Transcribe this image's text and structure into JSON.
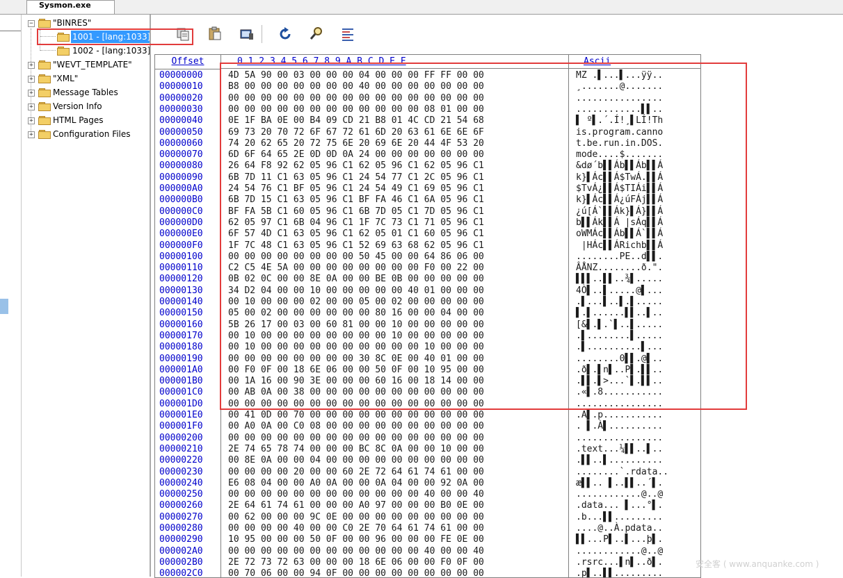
{
  "tab": {
    "title": "Sysmon.exe"
  },
  "tree": {
    "items": [
      {
        "label": "\"BINRES\"",
        "expander": "−",
        "level": 0
      },
      {
        "label": "1001 - [lang:1033]",
        "level": 1,
        "selected": true
      },
      {
        "label": "1002 - [lang:1033]",
        "level": 1
      },
      {
        "label": "\"WEVT_TEMPLATE\"",
        "expander": "+",
        "level": 0
      },
      {
        "label": "\"XML\"",
        "expander": "+",
        "level": 0
      },
      {
        "label": "Message Tables",
        "expander": "+",
        "level": 0
      },
      {
        "label": "Version Info",
        "expander": "+",
        "level": 0
      },
      {
        "label": "HTML Pages",
        "expander": "+",
        "level": 0
      },
      {
        "label": "Configuration Files",
        "expander": "+",
        "level": 0
      }
    ]
  },
  "toolbar": {
    "buttons": [
      {
        "name": "copy-icon"
      },
      {
        "name": "paste-icon"
      },
      {
        "name": "export-icon"
      },
      {
        "name": "refresh-icon"
      },
      {
        "name": "find-icon"
      },
      {
        "name": "properties-icon"
      }
    ]
  },
  "hex": {
    "header": {
      "offset": "Offset",
      "columns": "0  1  2  3  4  5  6  7  8  9  A  B  C  D  E  F",
      "ascii": "Ascii"
    },
    "rows": [
      {
        "off": "00000000",
        "hex": "4D 5A 90 00 03 00 00 00 04 00 00 00 FF FF 00 00",
        "asc": "MZ .▌...▌...ÿÿ.."
      },
      {
        "off": "00000010",
        "hex": "B8 00 00 00 00 00 00 00 40 00 00 00 00 00 00 00",
        "asc": "¸.......@......."
      },
      {
        "off": "00000020",
        "hex": "00 00 00 00 00 00 00 00 00 00 00 00 00 00 00 00",
        "asc": "................"
      },
      {
        "off": "00000030",
        "hex": "00 00 00 00 00 00 00 00 00 00 00 00 08 01 00 00",
        "asc": "............▌▌.."
      },
      {
        "off": "00000040",
        "hex": "0E 1F BA 0E 00 B4 09 CD 21 B8 01 4C CD 21 54 68",
        "asc": "▌ º▌.´.Í!¸▌LÍ!Th"
      },
      {
        "off": "00000050",
        "hex": "69 73 20 70 72 6F 67 72 61 6D 20 63 61 6E 6E 6F",
        "asc": "is.program.canno"
      },
      {
        "off": "00000060",
        "hex": "74 20 62 65 20 72 75 6E 20 69 6E 20 44 4F 53 20",
        "asc": "t.be.run.in.DOS."
      },
      {
        "off": "00000070",
        "hex": "6D 6F 64 65 2E 0D 0D 0A 24 00 00 00 00 00 00 00",
        "asc": "mode....$......."
      },
      {
        "off": "00000080",
        "hex": "26 64 F8 92 62 05 96 C1 62 05 96 C1 62 05 96 C1",
        "asc": "&dø´b▌▌Áb▌▌Áb▌▌Á"
      },
      {
        "off": "00000090",
        "hex": "6B 7D 11 C1 63 05 96 C1 24 54 77 C1 2C 05 96 C1",
        "asc": "k}▌Ác▌▌Á$TwÁ.▌▌Á"
      },
      {
        "off": "000000A0",
        "hex": "24 54 76 C1 BF 05 96 C1 24 54 49 C1 69 05 96 C1",
        "asc": "$TvÁ¿▌▌Á$TIÁi▌▌Á"
      },
      {
        "off": "000000B0",
        "hex": "6B 7D 15 C1 63 05 96 C1 BF FA 46 C1 6A 05 96 C1",
        "asc": "k}▌Ác▌▌Á¿úFÁj▌▌Á"
      },
      {
        "off": "000000C0",
        "hex": "BF FA 5B C1 60 05 96 C1 6B 7D 05 C1 7D 05 96 C1",
        "asc": "¿ú[Á`▌▌Ák}▌Á}▌▌Á"
      },
      {
        "off": "000000D0",
        "hex": "62 05 97 C1 6B 04 96 C1 1F 7C 73 C1 71 05 96 C1",
        "asc": "b▌▌Ák▌▌Á |sÁq▌▌Á"
      },
      {
        "off": "000000E0",
        "hex": "6F 57 4D C1 63 05 96 C1 62 05 01 C1 60 05 96 C1",
        "asc": "oWMÁc▌▌Áb▌▌Á`▌▌Á"
      },
      {
        "off": "000000F0",
        "hex": "1F 7C 48 C1 63 05 96 C1 52 69 63 68 62 05 96 C1",
        "asc": " |HÁc▌▌ÁRichb▌▌Á"
      },
      {
        "off": "00000100",
        "hex": "00 00 00 00 00 00 00 00 50 45 00 00 64 86 06 00",
        "asc": "........PE..d▌▌."
      },
      {
        "off": "00000110",
        "hex": "C2 C5 4E 5A 00 00 00 00 00 00 00 00 F0 00 22 00",
        "asc": "ÂÅNZ........ð.\"."
      },
      {
        "off": "00000120",
        "hex": "0B 02 0C 00 00 8E 0A 00 00 BE 0B 00 00 00 00 00",
        "asc": "▌▌▌..▌▌..¾▌....."
      },
      {
        "off": "00000130",
        "hex": "34 D2 04 00 00 10 00 00 00 00 00 40 01 00 00 00",
        "asc": "4Ò▌..▌.....@▌..."
      },
      {
        "off": "00000140",
        "hex": "00 10 00 00 00 02 00 00 05 00 02 00 00 00 00 00",
        "asc": ".▌...▌..▌.▌....."
      },
      {
        "off": "00000150",
        "hex": "05 00 02 00 00 00 00 00 00 80 16 00 00 04 00 00",
        "asc": "▌.▌......▌▌..▌.."
      },
      {
        "off": "00000160",
        "hex": "5B 26 17 00 03 00 60 81 00 00 10 00 00 00 00 00",
        "asc": "[&▌.▌.`▌..▌....."
      },
      {
        "off": "00000170",
        "hex": "00 10 00 00 00 00 00 00 00 00 10 00 00 00 00 00",
        "asc": ".▌........▌....."
      },
      {
        "off": "00000180",
        "hex": "00 10 00 00 00 00 00 00 00 00 00 00 10 00 00 00",
        "asc": ".▌..........▌..."
      },
      {
        "off": "00000190",
        "hex": "00 00 00 00 00 00 00 00 30 8C 0E 00 40 01 00 00",
        "asc": "........0▌▌.@▌.."
      },
      {
        "off": "000001A0",
        "hex": "00 F0 0F 00 18 6E 06 00 00 50 0F 00 10 95 00 00",
        "asc": ".ð▌.▌n▌..P▌.▌▌.."
      },
      {
        "off": "000001B0",
        "hex": "00 1A 16 00 90 3E 00 00 00 60 16 00 18 14 00 00",
        "asc": ".▌▌.▌>...`▌.▌▌.."
      },
      {
        "off": "000001C0",
        "hex": "00 AB 0A 00 38 00 00 00 00 00 00 00 00 00 00 00",
        "asc": ".«▌.8..........."
      },
      {
        "off": "000001D0",
        "hex": "00 00 00 00 00 00 00 00 00 00 00 00 00 00 00 00",
        "asc": "................"
      },
      {
        "off": "000001E0",
        "hex": "00 41 0D 00 70 00 00 00 00 00 00 00 00 00 00 00",
        "asc": ".A▌.p..........."
      },
      {
        "off": "000001F0",
        "hex": "00 A0 0A 00 C0 08 00 00 00 00 00 00 00 00 00 00",
        "asc": ". ▌.À▌.........."
      },
      {
        "off": "00000200",
        "hex": "00 00 00 00 00 00 00 00 00 00 00 00 00 00 00 00",
        "asc": "................"
      },
      {
        "off": "00000210",
        "hex": "2E 74 65 78 74 00 00 00 BC 8C 0A 00 00 10 00 00",
        "asc": ".text...¼▌▌..▌.."
      },
      {
        "off": "00000220",
        "hex": "00 8E 0A 00 00 04 00 00 00 00 00 00 00 00 00 00",
        "asc": ".▌▌..▌.........."
      },
      {
        "off": "00000230",
        "hex": "00 00 00 00 20 00 00 60 2E 72 64 61 74 61 00 00",
        "asc": "........`.rdata.."
      },
      {
        "off": "00000240",
        "hex": "E6 08 04 00 00 A0 0A 00 00 0A 04 00 00 92 0A 00",
        "asc": "æ▌▌.. ▌..▌▌..´▌."
      },
      {
        "off": "00000250",
        "hex": "00 00 00 00 00 00 00 00 00 00 00 00 40 00 00 40",
        "asc": "............@..@"
      },
      {
        "off": "00000260",
        "hex": "2E 64 61 74 61 00 00 00 A0 97 00 00 00 B0 0E 00",
        "asc": ".data... ▌...°▌."
      },
      {
        "off": "00000270",
        "hex": "00 62 00 00 00 9C 0E 00 00 00 00 00 00 00 00 00",
        "asc": ".b...▌▌........."
      },
      {
        "off": "00000280",
        "hex": "00 00 00 00 40 00 00 C0 2E 70 64 61 74 61 00 00",
        "asc": "....@..À.pdata.."
      },
      {
        "off": "00000290",
        "hex": "10 95 00 00 00 50 0F 00 00 96 00 00 00 FE 0E 00",
        "asc": "▌▌...P▌..▌...þ▌."
      },
      {
        "off": "000002A0",
        "hex": "00 00 00 00 00 00 00 00 00 00 00 00 40 00 00 40",
        "asc": "............@..@"
      },
      {
        "off": "000002B0",
        "hex": "2E 72 73 72 63 00 00 00 18 6E 06 00 00 F0 0F 00",
        "asc": ".rsrc...▌n▌..ð▌."
      },
      {
        "off": "000002C0",
        "hex": "00 70 06 00 00 94 0F 00 00 00 00 00 00 00 00 00",
        "asc": ".p▌..▌▌........."
      }
    ]
  },
  "watermark": "安全客 ( www.anquanke.com )"
}
